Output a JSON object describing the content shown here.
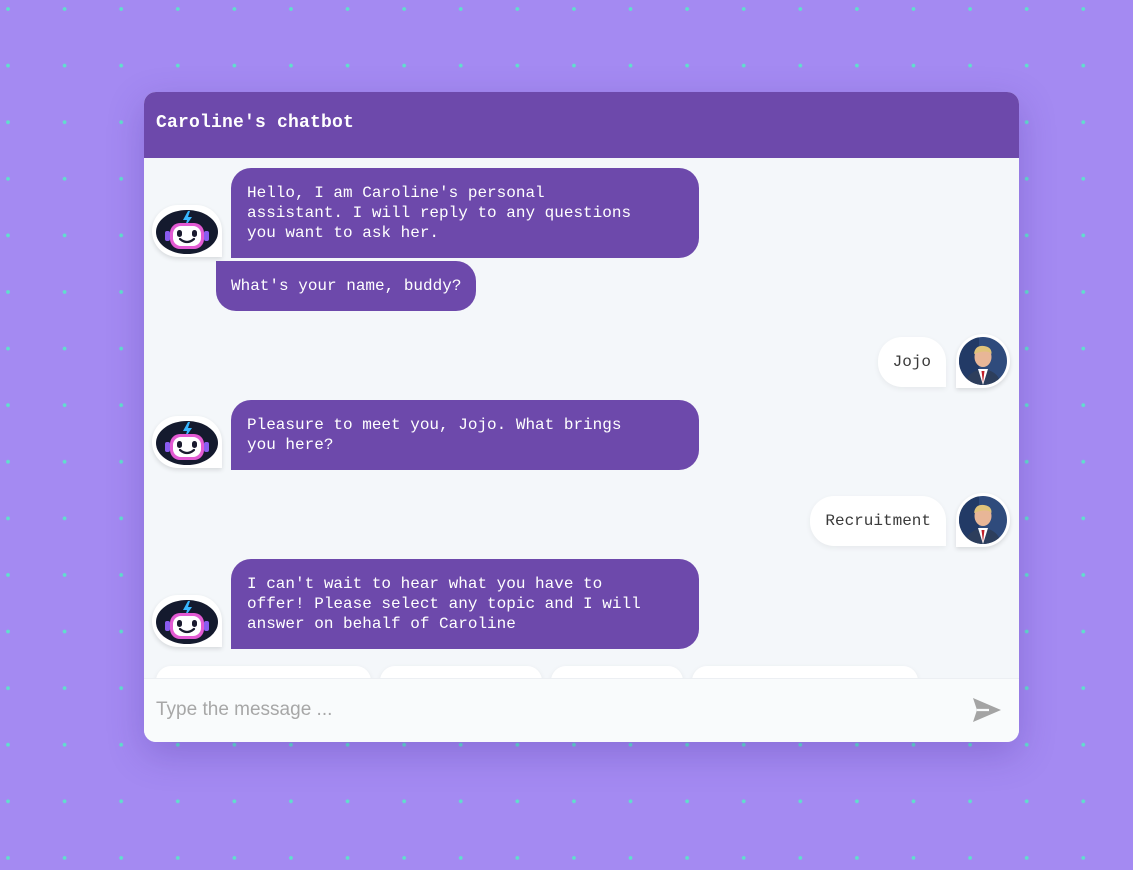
{
  "header": {
    "title": "Caroline's chatbot"
  },
  "messages": [
    {
      "sender": "bot",
      "text": "Hello, I am Caroline's personal\nassistant. I will reply to any questions\nyou want to ask her."
    },
    {
      "sender": "bot",
      "text": "What's your name, buddy?"
    },
    {
      "sender": "user",
      "text": "Jojo"
    },
    {
      "sender": "bot",
      "text": "Pleasure to meet you, Jojo. What brings\nyou here?"
    },
    {
      "sender": "user",
      "text": "Recruitment"
    },
    {
      "sender": "bot",
      "text": "I can't wait to hear what you have to\noffer! Please select any topic and I will\nanswer on behalf of Caroline"
    }
  ],
  "composer": {
    "placeholder": "Type the message ...",
    "send_icon": "send-icon"
  },
  "icons": {
    "bot_avatar": "robot-face-icon",
    "user_avatar": "user-photo-avatar"
  },
  "colors": {
    "background": "#a48af2",
    "dot": "#5fe0cc",
    "header": "#6d49ab",
    "bot_bubble": "#6d49ab",
    "user_bubble": "#ffffff",
    "chat_body": "#f4f7fa"
  }
}
